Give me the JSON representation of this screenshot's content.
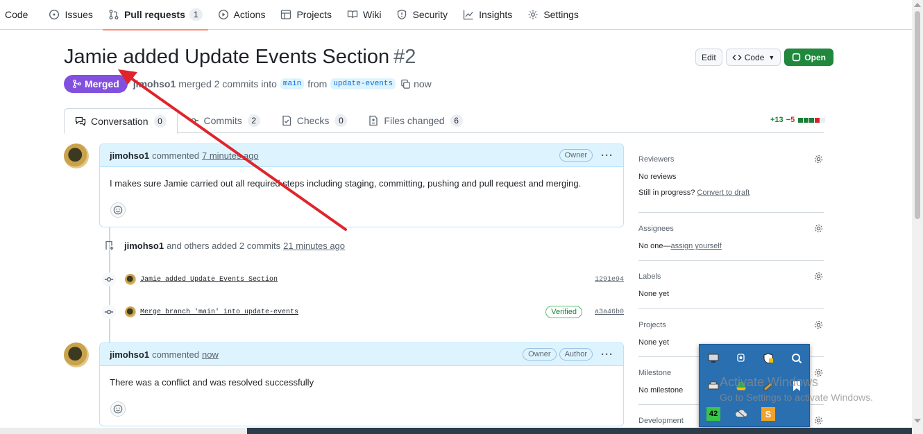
{
  "repo_nav": {
    "items": [
      {
        "label": "Code",
        "icon": "code-icon"
      },
      {
        "label": "Issues",
        "icon": "issue-opened-icon"
      },
      {
        "label": "Pull requests",
        "icon": "git-pull-request-icon",
        "count": "1",
        "active": true
      },
      {
        "label": "Actions",
        "icon": "play-icon"
      },
      {
        "label": "Projects",
        "icon": "table-icon"
      },
      {
        "label": "Wiki",
        "icon": "book-icon"
      },
      {
        "label": "Security",
        "icon": "shield-icon"
      },
      {
        "label": "Insights",
        "icon": "graph-icon"
      },
      {
        "label": "Settings",
        "icon": "gear-icon"
      }
    ]
  },
  "pr": {
    "title": "Jamie added Update Events Section",
    "number": "#2",
    "state": "Merged",
    "author": "jimohso1",
    "merge_text": "merged 2 commits into",
    "base_branch": "main",
    "from_text": "from",
    "head_branch": "update-events",
    "time": "now"
  },
  "header_actions": {
    "edit_label": "Edit",
    "code_label": "Code",
    "open_label": "Open"
  },
  "tabs": [
    {
      "label": "Conversation",
      "count": "0",
      "icon": "comment-discussion-icon",
      "active": true
    },
    {
      "label": "Commits",
      "count": "2",
      "icon": "git-commit-icon"
    },
    {
      "label": "Checks",
      "count": "0",
      "icon": "checklist-icon"
    },
    {
      "label": "Files changed",
      "count": "6",
      "icon": "file-diff-icon"
    }
  ],
  "diffstat": {
    "additions": "+13",
    "deletions": "−5",
    "colors": [
      "#1a7f37",
      "#1a7f37",
      "#1a7f37",
      "#d1242f",
      "#eaeef2"
    ]
  },
  "comments": [
    {
      "author": "jimohso1",
      "verb": "commented",
      "time": "7 minutes ago",
      "labels": [
        "Owner"
      ],
      "body": "I makes sure Jamie carried out all required steps including staging, committing, pushing and pull request and merging."
    },
    {
      "author": "jimohso1",
      "verb": "commented",
      "time": "now",
      "labels": [
        "Owner",
        "Author"
      ],
      "body": "There was a conflict and was resolved successfully"
    }
  ],
  "commit_event": {
    "author": "jimohso1",
    "text": "and others added 2 commits",
    "time": "21 minutes ago",
    "commits": [
      {
        "message": "Jamie added Update Events Section",
        "sha": "1291e94",
        "verified": ""
      },
      {
        "message": "Merge branch 'main' into update-events",
        "sha": "a3a46b0",
        "verified": "Verified"
      }
    ]
  },
  "sidebar": {
    "reviewers": {
      "title": "Reviewers",
      "line1": "No reviews",
      "line2_prefix": "Still in progress?",
      "line2_link": "Convert to draft"
    },
    "assignees": {
      "title": "Assignees",
      "prefix": "No one—",
      "link": "assign yourself"
    },
    "labels": {
      "title": "Labels",
      "value": "None yet"
    },
    "projects": {
      "title": "Projects",
      "value": "None yet"
    },
    "milestone": {
      "title": "Milestone",
      "value": "No milestone"
    },
    "development": {
      "title": "Development"
    }
  },
  "tray": {
    "badge_number": "42",
    "icons": [
      "monitor-icon",
      "webcam-icon",
      "security-shield-icon",
      "search-app-icon",
      "printer-icon",
      "drive-icon",
      "pen-tool-icon",
      "store-icon",
      "counter-icon",
      "cloud-off-icon",
      "s-app-icon"
    ]
  },
  "watermark": {
    "line1": "Activate Windows",
    "line2": "Go to Settings to activate Windows."
  },
  "annotation": {
    "color": "#e0242b"
  }
}
